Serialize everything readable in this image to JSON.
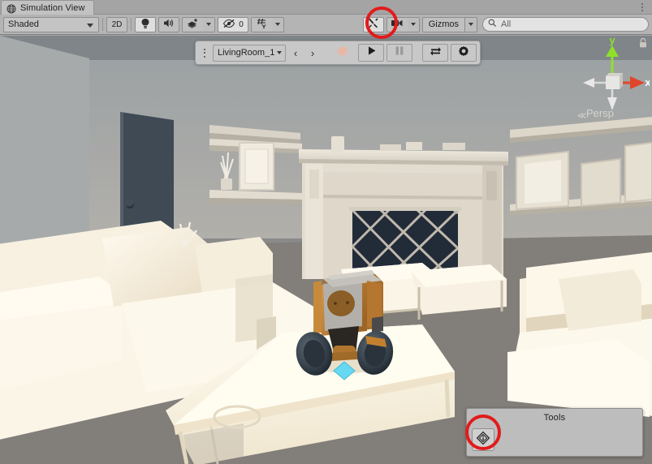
{
  "window": {
    "tab_label": "Simulation View",
    "tab_icon": "globe-icon",
    "tab_menu_icon": "kebab-menu-icon"
  },
  "toolbar": {
    "draw_mode": {
      "label": "Shaded",
      "icon": "chevron-down-icon"
    },
    "two_d_label": "2D",
    "lighting_icon": "lightbulb-icon",
    "audio_icon": "speaker-icon",
    "fx_icon": "effects-icon",
    "fx_dropdown_icon": "chevron-down-icon",
    "hidden_objects_icon": "eye-slash-icon",
    "hidden_objects_count": "0",
    "scene_visibility_icon": "grid-visibility-icon",
    "scene_visibility_dropdown_icon": "chevron-down-icon",
    "tools_icon": "wrench-screwdriver-icon",
    "camera_icon": "camera-icon",
    "camera_dropdown_icon": "chevron-down-icon",
    "gizmos_label": "Gizmos",
    "gizmos_dropdown_icon": "chevron-down-icon",
    "search": {
      "icon": "search-icon",
      "value": "All",
      "placeholder": "All"
    }
  },
  "play_overlay": {
    "handle_icon": "drag-handle-dots-icon",
    "scene_select": {
      "value": "LivingRoom_1",
      "icon": "chevron-down-icon"
    },
    "prev_label": "‹",
    "next_label": "›",
    "record_icon": "record-icon",
    "play_icon": "play-icon",
    "pause_icon": "pause-icon",
    "loop_icon": "loop-icon",
    "settings_icon": "gear-icon"
  },
  "tools_panel": {
    "title": "Tools",
    "button_icon": "diamond-info-icon"
  },
  "scene_gizmo": {
    "axis_x_label": "x",
    "axis_y_label": "y",
    "projection_label": "Persp",
    "projection_arrow": "≪",
    "lock_icon": "lock-icon"
  },
  "scene": {
    "name": "living-room-3d-viewport",
    "description": "Living room with fireplace, sofas, coffee table and a wheeled robot"
  },
  "annotations": [
    {
      "name": "annot-tools-btn",
      "target": "toolbar-tools-button",
      "color": "#e21b1b",
      "shape": "circle"
    },
    {
      "name": "annot-tools-panel",
      "target": "tools-panel-button",
      "color": "#e21b1b",
      "shape": "circle"
    }
  ],
  "colors": {
    "toolbar_bg": "#b4b4b4",
    "tab_bg": "#c2c2c2",
    "panel_bg": "#bdbdbd",
    "annotation_red": "#e21b1b",
    "gizmo_x": "#e0462a",
    "gizmo_y": "#8ee02a",
    "selection_diamond": "#66d8f2",
    "wall": "#8d9093",
    "furniture": "#f4e9d6",
    "robot_body": "#c07f33"
  }
}
